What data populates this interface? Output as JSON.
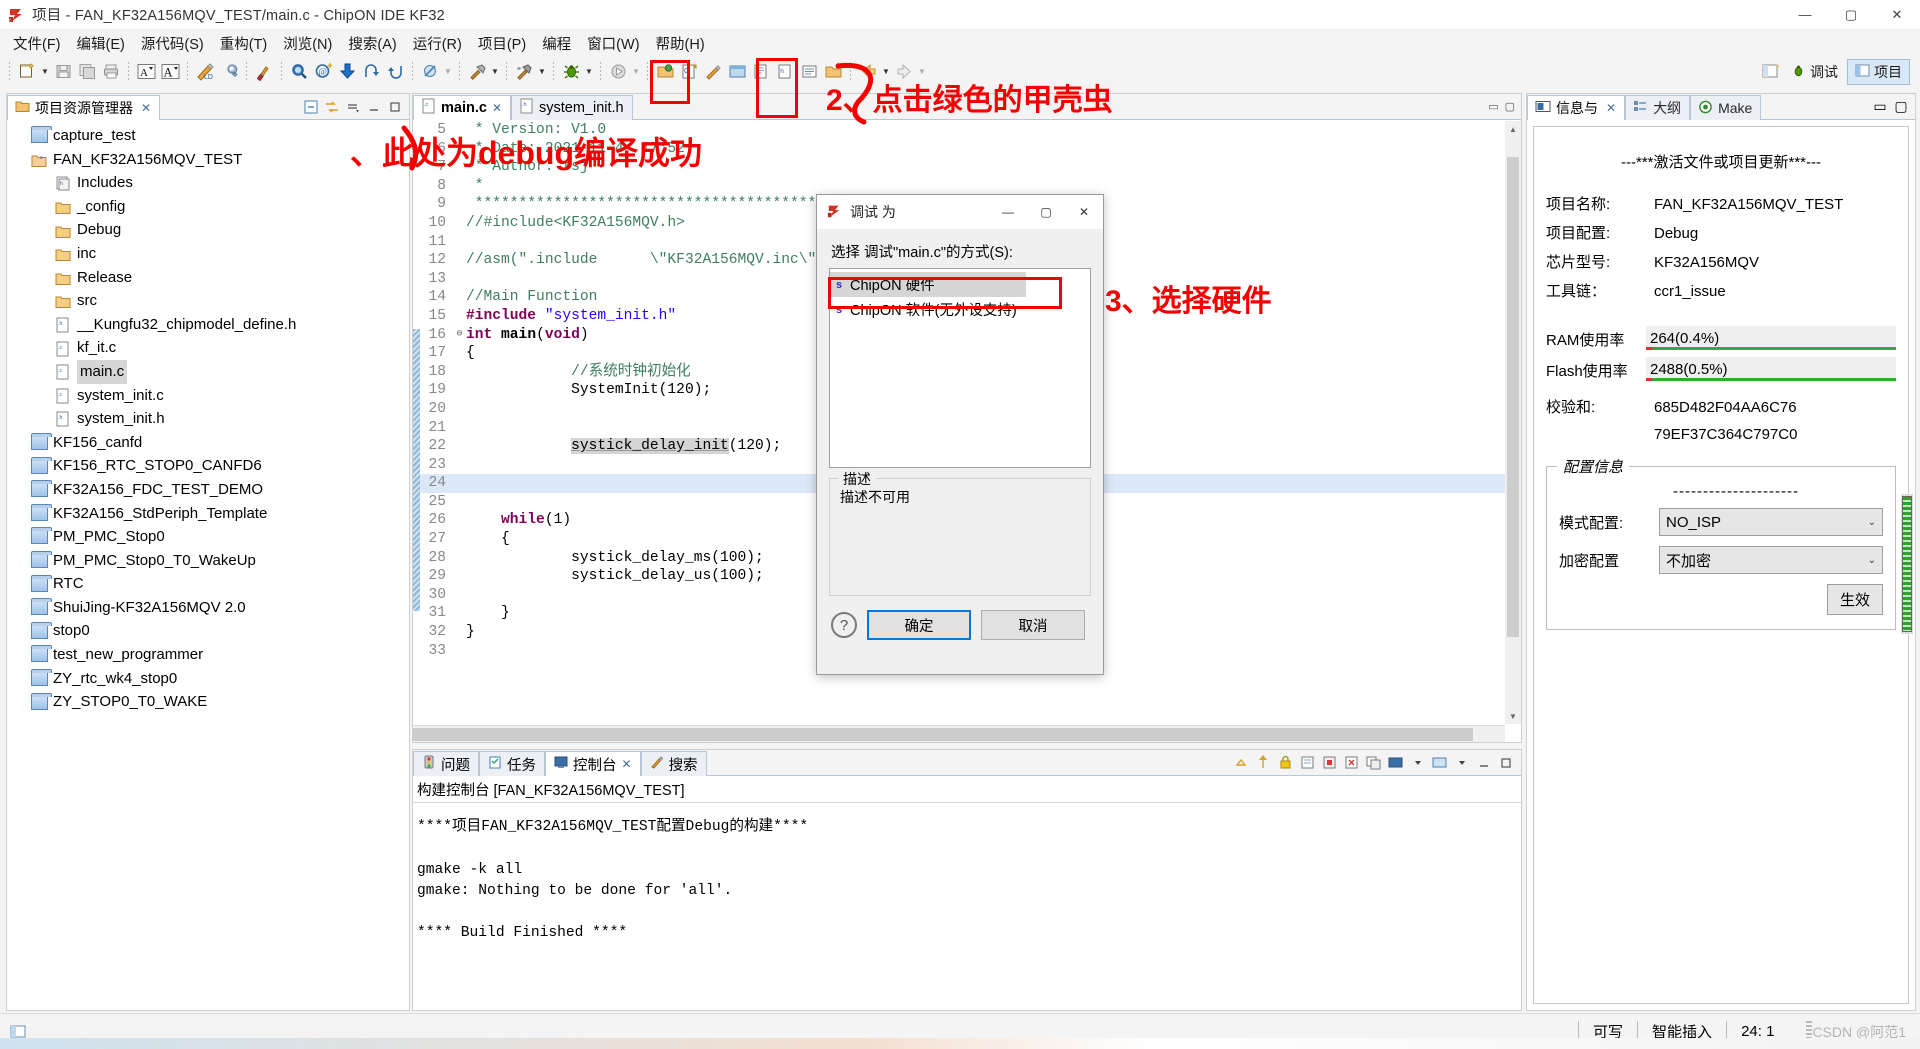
{
  "window": {
    "title": "项目  -  FAN_KF32A156MQV_TEST/main.c  -  ChipON IDE KF32",
    "minimize": "—",
    "maximize": "▢",
    "close": "✕"
  },
  "menubar": {
    "items": [
      "文件(F)",
      "编辑(E)",
      "源代码(S)",
      "重构(T)",
      "浏览(N)",
      "搜索(A)",
      "运行(R)",
      "项目(P)",
      "编程",
      "窗口(W)",
      "帮助(H)"
    ]
  },
  "toolbar": {
    "perspectives": [
      {
        "label": "调试",
        "icon": "bug-icon",
        "active": false
      },
      {
        "label": "项目",
        "icon": "project-icon",
        "active": true
      }
    ],
    "icons": [
      "new-icon",
      "save-icon",
      "save-all-icon",
      "print-icon",
      "toggle-ascii-icon",
      "toggle-caps-icon",
      "build-all-icon",
      "wrench-icon",
      "broom-icon",
      "search-icon",
      "open-type-icon",
      "download-icon",
      "step-return-icon",
      "step-into-icon",
      "skip-icon",
      "build-hammer-icon",
      "build-hammer2-icon",
      "debug-bug-icon",
      "run-icon",
      "open-resource-icon",
      "new-c-icon",
      "pencil-icon",
      "terminal-icon",
      "new-file-icon",
      "new-class-icon",
      "toggle-icon",
      "back-icon",
      "forward-icon"
    ]
  },
  "explorer": {
    "tab_label": "项目资源管理器",
    "close_glyph": "✕",
    "actions": [
      "collapse-all-icon",
      "link-editor-icon",
      "view-menu-icon",
      "minimize-icon",
      "maximize-icon"
    ],
    "tree": [
      {
        "label": "capture_test",
        "icon": "project-closed-icon",
        "indent": 0,
        "selected": false
      },
      {
        "label": "FAN_KF32A156MQV_TEST",
        "icon": "project-open-icon",
        "indent": 0,
        "selected": false
      },
      {
        "label": "Includes",
        "icon": "includes-icon",
        "indent": 1,
        "selected": false
      },
      {
        "label": "_config",
        "icon": "folder-icon",
        "indent": 1,
        "selected": false
      },
      {
        "label": "Debug",
        "icon": "folder-icon",
        "indent": 1,
        "selected": false
      },
      {
        "label": "inc",
        "icon": "folder-icon",
        "indent": 1,
        "selected": false
      },
      {
        "label": "Release",
        "icon": "folder-icon",
        "indent": 1,
        "selected": false
      },
      {
        "label": "src",
        "icon": "folder-icon",
        "indent": 1,
        "selected": false
      },
      {
        "label": "__Kungfu32_chipmodel_define.h",
        "icon": "h-file-icon",
        "indent": 1,
        "selected": false
      },
      {
        "label": "kf_it.c",
        "icon": "c-file-icon",
        "indent": 1,
        "selected": false
      },
      {
        "label": "main.c",
        "icon": "c-file-icon",
        "indent": 1,
        "selected": true
      },
      {
        "label": "system_init.c",
        "icon": "c-file-icon",
        "indent": 1,
        "selected": false
      },
      {
        "label": "system_init.h",
        "icon": "h-file-icon",
        "indent": 1,
        "selected": false
      },
      {
        "label": "KF156_canfd",
        "icon": "project-closed-icon",
        "indent": 0,
        "selected": false
      },
      {
        "label": "KF156_RTC_STOP0_CANFD6",
        "icon": "project-closed-icon",
        "indent": 0,
        "selected": false
      },
      {
        "label": "KF32A156_FDC_TEST_DEMO",
        "icon": "project-closed-icon",
        "indent": 0,
        "selected": false
      },
      {
        "label": "KF32A156_StdPeriph_Template",
        "icon": "project-closed-icon",
        "indent": 0,
        "selected": false
      },
      {
        "label": "PM_PMC_Stop0",
        "icon": "project-closed-icon",
        "indent": 0,
        "selected": false
      },
      {
        "label": "PM_PMC_Stop0_T0_WakeUp",
        "icon": "project-closed-icon",
        "indent": 0,
        "selected": false
      },
      {
        "label": "RTC",
        "icon": "project-closed-icon",
        "indent": 0,
        "selected": false
      },
      {
        "label": "ShuiJing-KF32A156MQV 2.0",
        "icon": "project-closed-icon",
        "indent": 0,
        "selected": false
      },
      {
        "label": "stop0",
        "icon": "project-closed-icon",
        "indent": 0,
        "selected": false
      },
      {
        "label": "test_new_programmer",
        "icon": "project-closed-icon",
        "indent": 0,
        "selected": false
      },
      {
        "label": "ZY_rtc_wk4_stop0",
        "icon": "project-closed-icon",
        "indent": 0,
        "selected": false
      },
      {
        "label": "ZY_STOP0_T0_WAKE",
        "icon": "project-closed-icon",
        "indent": 0,
        "selected": false
      }
    ]
  },
  "editor": {
    "tabs": [
      {
        "label": "main.c",
        "icon": "c-file-icon",
        "active": true,
        "close": "✕"
      },
      {
        "label": "system_init.h",
        "icon": "h-file-icon",
        "active": false,
        "close": ""
      }
    ],
    "minimize": "▭",
    "maximize": "▢",
    "lines": [
      {
        "no": "5",
        "text": " * Version: V1.0",
        "kind": "comment"
      },
      {
        "no": "6",
        "text": " * Date: 2021-11-4  17:52",
        "kind": "comment"
      },
      {
        "no": "7",
        "text": " * Author: fsj",
        "kind": "comment"
      },
      {
        "no": "8",
        "text": " *",
        "kind": "comment"
      },
      {
        "no": "9",
        "text": " ************************************************************/",
        "kind": "comment"
      },
      {
        "no": "10",
        "text": "//#include<KF32A156MQV.h>",
        "kind": "comment"
      },
      {
        "no": "11",
        "text": "",
        "kind": "plain"
      },
      {
        "no": "12",
        "text": "//asm(\".include      \\\"KF32A156MQV.inc\\\"\");",
        "kind": "comment"
      },
      {
        "no": "13",
        "text": "",
        "kind": "plain"
      },
      {
        "no": "14",
        "text": "//Main Function",
        "kind": "comment"
      },
      {
        "no": "15",
        "text": "#include \"system_init.h\"",
        "kind": "include"
      },
      {
        "no": "16",
        "text": "int main(void)",
        "kind": "signature",
        "fold": "⊖"
      },
      {
        "no": "17",
        "text": "{",
        "kind": "plain"
      },
      {
        "no": "18",
        "text": "            //系统时钟初始化",
        "kind": "comment"
      },
      {
        "no": "19",
        "text": "            SystemInit(120);",
        "kind": "plain"
      },
      {
        "no": "20",
        "text": "",
        "kind": "plain"
      },
      {
        "no": "21",
        "text": "",
        "kind": "plain"
      },
      {
        "no": "22",
        "text": "            systick_delay_init(120);",
        "kind": "highlighted"
      },
      {
        "no": "23",
        "text": "",
        "kind": "plain"
      },
      {
        "no": "24",
        "text": "",
        "kind": "current"
      },
      {
        "no": "25",
        "text": "",
        "kind": "plain"
      },
      {
        "no": "26",
        "text": "    while(1)",
        "kind": "while"
      },
      {
        "no": "27",
        "text": "    {",
        "kind": "plain"
      },
      {
        "no": "28",
        "text": "            systick_delay_ms(100);",
        "kind": "plain"
      },
      {
        "no": "29",
        "text": "            systick_delay_us(100);",
        "kind": "plain"
      },
      {
        "no": "30",
        "text": "",
        "kind": "plain"
      },
      {
        "no": "31",
        "text": "    }",
        "kind": "plain"
      },
      {
        "no": "32",
        "text": "}",
        "kind": "plain"
      },
      {
        "no": "33",
        "text": "",
        "kind": "plain"
      }
    ]
  },
  "console": {
    "tabs": [
      {
        "label": "问题",
        "icon": "problems-icon",
        "active": false,
        "close": ""
      },
      {
        "label": "任务",
        "icon": "tasks-icon",
        "active": false,
        "close": ""
      },
      {
        "label": "控制台",
        "icon": "console-icon",
        "active": true,
        "close": "✕"
      },
      {
        "label": "搜索",
        "icon": "search-icon",
        "active": false,
        "close": ""
      }
    ],
    "title": "构建控制台 [FAN_KF32A156MQV_TEST]",
    "body": "****项目FAN_KF32A156MQV_TEST配置Debug的构建****\n\ngmake -k all\ngmake: Nothing to be done for 'all'.\n\n**** Build Finished ****",
    "actions": [
      "scroll-lock-icon",
      "pin-icon",
      "clear-icon",
      "terminate-icon",
      "remove-icon",
      "remove-all-icon",
      "open-console-icon",
      "display-console-icon",
      "view-menu-icon",
      "minimize-icon",
      "maximize-icon"
    ]
  },
  "info_panel": {
    "tabs": [
      {
        "label": "信息与",
        "icon": "info-icon",
        "active": true,
        "close": "✕"
      },
      {
        "label": "大纲",
        "icon": "outline-icon",
        "active": false,
        "close": ""
      },
      {
        "label": "Make",
        "icon": "make-icon",
        "active": false,
        "close": ""
      }
    ],
    "minimize": "▭",
    "maximize": "▢",
    "header": "---***激活文件或项目更新***---",
    "fields": [
      {
        "key": "项目名称:",
        "value": "FAN_KF32A156MQV_TEST"
      },
      {
        "key": "项目配置:",
        "value": "Debug"
      },
      {
        "key": "芯片型号:",
        "value": "KF32A156MQV"
      },
      {
        "key": "工具链：",
        "value": "ccr1_issue"
      }
    ],
    "usage": [
      {
        "key": "RAM使用率",
        "value": "264(0.4%)"
      },
      {
        "key": "Flash使用率",
        "value": "2488(0.5%)"
      }
    ],
    "checksum": {
      "key": "校验和:",
      "line1": "685D482F04AA6C76",
      "line2": "79EF37C364C797C0"
    },
    "config_group": {
      "legend": "配置信息",
      "dashes": "---------------------",
      "rows": [
        {
          "key": "模式配置:",
          "value": "NO_ISP",
          "chevron": "⌄"
        },
        {
          "key": "加密配置",
          "value": "不加密",
          "chevron": "⌄"
        }
      ],
      "apply_label": "生效"
    },
    "accent_green": "#2fa12f"
  },
  "dialog": {
    "title": "调试 为",
    "minimize": "—",
    "maximize": "▢",
    "close": "✕",
    "prompt": "选择 调试\"main.c\"的方式(S):",
    "options": [
      {
        "prefix": "s",
        "label": "ChipON 硬件",
        "selected": true
      },
      {
        "prefix": "s",
        "label": "ChipON 软件(无外设支持)",
        "selected": false
      }
    ],
    "desc_legend": "描述",
    "desc_text": "描述不可用",
    "help_glyph": "?",
    "ok_label": "确定",
    "cancel_label": "取消"
  },
  "annotations": [
    {
      "id": "anno-1",
      "text": "、此处为debug编译成功"
    },
    {
      "id": "anno-2",
      "text": "2、点击绿色的甲壳虫"
    },
    {
      "id": "anno-3",
      "text": "3、选择硬件"
    }
  ],
  "statusbar": {
    "writable": "可写",
    "insert_mode": "智能插入",
    "position": "24: 1",
    "watermark": "CSDN @阿范1"
  },
  "colors": {
    "anno_red": "#f40000",
    "tab_border": "#b8c6d6",
    "selection": "#d6d6d6",
    "current_line": "#dce8f7",
    "accent_blue": "#0078d7"
  }
}
